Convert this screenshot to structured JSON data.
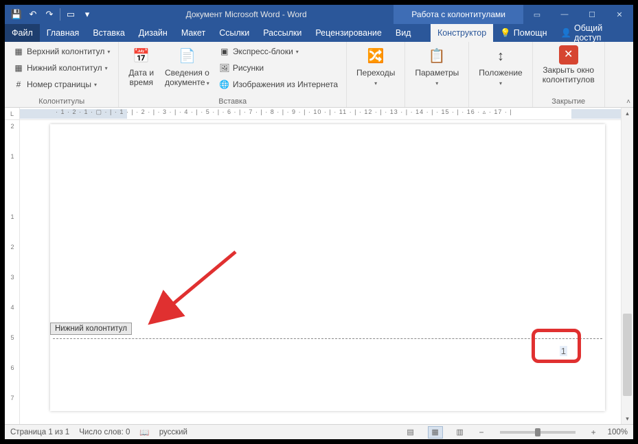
{
  "title": "Документ Microsoft Word - Word",
  "tool_tab": "Работа с колонтитулами",
  "window_controls": {
    "ribbon_opts": "▭",
    "min": "—",
    "max": "☐",
    "close": "✕"
  },
  "qat": {
    "save": "💾",
    "undo": "↶",
    "redo": "↷",
    "new": "▭",
    "more": "▾"
  },
  "tabs": {
    "file": "Файл",
    "home": "Главная",
    "insert": "Вставка",
    "design": "Дизайн",
    "layout": "Макет",
    "references": "Ссылки",
    "mailings": "Рассылки",
    "review": "Рецензирование",
    "view": "Вид",
    "designer": "Конструктор"
  },
  "help_label": "Помощн",
  "share_label": "Общий доступ",
  "ribbon": {
    "group1": {
      "header": "Верхний колонтитул",
      "footer": "Нижний колонтитул",
      "pagenum": "Номер страницы",
      "label": "Колонтитулы"
    },
    "group2": {
      "datetime_l1": "Дата и",
      "datetime_l2": "время",
      "docinfo_l1": "Сведения о",
      "docinfo_l2": "документе",
      "quickparts": "Экспресс-блоки",
      "pictures": "Рисунки",
      "online": "Изображения из Интернета",
      "label": "Вставка"
    },
    "group3": {
      "nav": "Переходы",
      "opts": "Параметры",
      "pos": "Положение"
    },
    "group4": {
      "close_l1": "Закрыть окно",
      "close_l2": "колонтитулов",
      "label": "Закрытие"
    }
  },
  "ruler_corner": "L",
  "ruler_h": "· 1 · 2 · 1 · ▢ · | · 1 · | · 2 · | · 3 · | · 4 · | · 5 · | · 6 · | · 7 · | · 8 · | · 9 · | · 10 · | · 11 · | · 12 · | · 13 · | · 14 · | · 15 · | · 16 · ▵ · 17 · |",
  "ruler_v": [
    "2",
    "1",
    "",
    "1",
    "2",
    "3",
    "4",
    "5",
    "6",
    "7"
  ],
  "footer_tag": "Нижний колонтитул",
  "page_number": "1",
  "status": {
    "page": "Страница 1 из 1",
    "words": "Число слов: 0",
    "lang": "русский",
    "zoom": "100%"
  }
}
